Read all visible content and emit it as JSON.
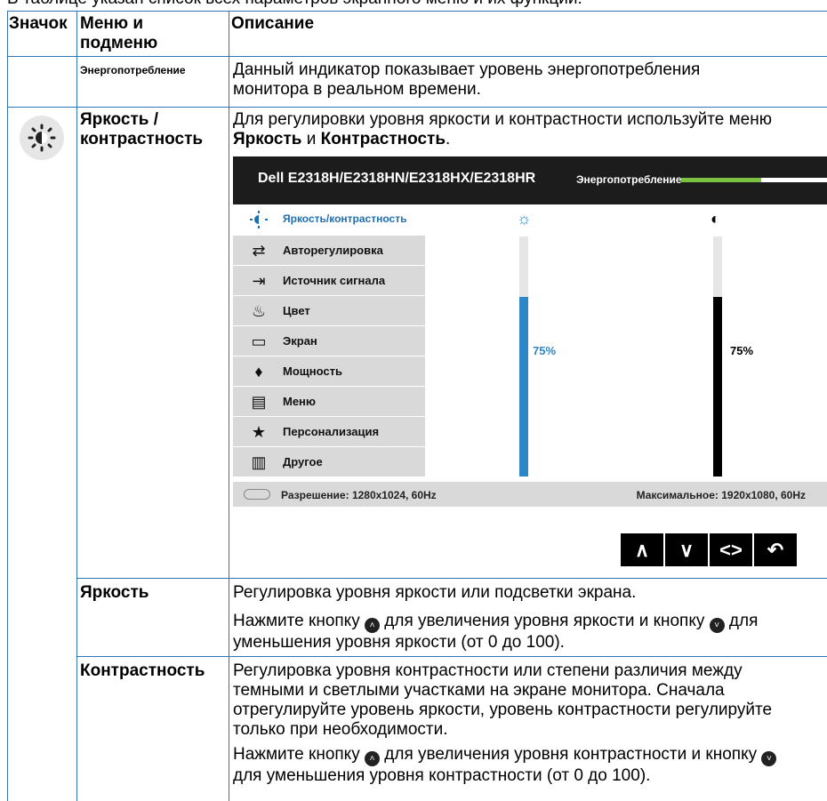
{
  "intro_text": "В таблице указан список всех параметров экранного меню и их функции:",
  "table": {
    "headers": [
      "Значок",
      "Меню и подменю",
      "Описание"
    ],
    "rows": [
      {
        "menu": "Энергопотребление",
        "desc": "Данный индикатор показывает уровень энергопотребления монитора в реальном времени."
      },
      {
        "menu": "Яркость / контрастность",
        "desc_parts": [
          "Для регулировки уровня яркости и контрастности используйте меню ",
          "Яркость",
          " и ",
          "Контрастность",
          "."
        ]
      },
      {
        "menu": "Яркость",
        "desc_p1": "Регулировка уровня яркости или подсветки экрана.",
        "desc_p2a": "Нажмите кнопку",
        "desc_p2b": "для увеличения уровня яркости и кнопку",
        "desc_p2c": "для уменьшения уровня яркости (от 0 до 100)."
      },
      {
        "menu": "Контрастность",
        "desc_p1": "Регулировка уровня контрастности или степени различия между темными и светлыми участками на экране монитора. Сначала отрегулируйте уровень яркости, уровень контрастности регулируйте только при необходимости.",
        "desc_p2a": "Нажмите кнопку",
        "desc_p2b": "для увеличения уровня контрастности и кнопку",
        "desc_p2c": "для уменьшения уровня контрастности (от 0 до 100)."
      }
    ]
  },
  "osd": {
    "model": "Dell E2318H/E2318HN/E2318HX/E2318HR",
    "power_label": "Энергопотребление",
    "power_level": 0.55,
    "menu_items": [
      {
        "label": "Яркость/контрастность",
        "icon": "brightness-icon"
      },
      {
        "label": "Авторегулировка",
        "icon": "auto-adjust-icon"
      },
      {
        "label": "Источник сигнала",
        "icon": "input-source-icon"
      },
      {
        "label": "Цвет",
        "icon": "color-icon"
      },
      {
        "label": "Экран",
        "icon": "display-icon"
      },
      {
        "label": "Мощность",
        "icon": "power-icon"
      },
      {
        "label": "Меню",
        "icon": "menu-icon"
      },
      {
        "label": "Персонализация",
        "icon": "star-icon"
      },
      {
        "label": "Другое",
        "icon": "other-icon"
      }
    ],
    "brightness_value": "75%",
    "contrast_value": "75%",
    "brightness_level": 0.75,
    "contrast_level": 0.75,
    "brightness_color": "#2e86c8",
    "contrast_color": "#000000",
    "resolution": "Разрешение: 1280x1024, 60Hz",
    "max_resolution": "Максимальное: 1920x1080, 60Hz",
    "nav_buttons": [
      "∧",
      "∨",
      "<>",
      "↶"
    ]
  },
  "inline_button_up": "˄",
  "inline_button_down": "˅"
}
